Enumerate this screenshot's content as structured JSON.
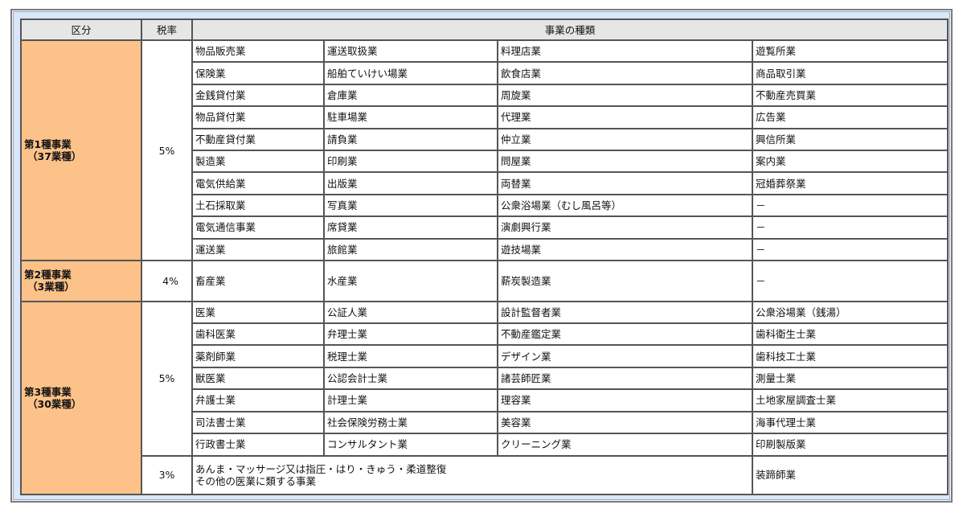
{
  "header": {
    "category": "区分",
    "rate": "税率",
    "types": "事業の種類"
  },
  "colors": {
    "category_bg": "#fdc289",
    "header_bg": "#e6e6e6",
    "frame_bg": "#d9e6fb"
  },
  "categories": [
    {
      "name": "第1種事業",
      "count": "（37業種）",
      "groups": [
        {
          "rate": "5%",
          "rows": [
            [
              "物品販売業",
              "運送取扱業",
              "料理店業",
              "遊覧所業"
            ],
            [
              "保険業",
              "船舶ていけい場業",
              "飲食店業",
              "商品取引業"
            ],
            [
              "金銭貸付業",
              "倉庫業",
              "周旋業",
              "不動産売買業"
            ],
            [
              "物品貸付業",
              "駐車場業",
              "代理業",
              "広告業"
            ],
            [
              "不動産貸付業",
              "請負業",
              "仲立業",
              "興信所業"
            ],
            [
              "製造業",
              "印刷業",
              "問屋業",
              "案内業"
            ],
            [
              "電気供給業",
              "出版業",
              "両替業",
              "冠婚葬祭業"
            ],
            [
              "土石採取業",
              "写真業",
              "公衆浴場業（むし風呂等）",
              "－"
            ],
            [
              "電気通信事業",
              "席貸業",
              "演劇興行業",
              "－"
            ],
            [
              "運送業",
              "旅館業",
              "遊技場業",
              "－"
            ]
          ]
        }
      ]
    },
    {
      "name": "第2種事業",
      "count": "（3業種）",
      "groups": [
        {
          "rate": "4%",
          "rows": [
            [
              "畜産業",
              "水産業",
              "薪炭製造業",
              "－"
            ]
          ]
        }
      ]
    },
    {
      "name": "第3種事業",
      "count": "（30業種）",
      "groups": [
        {
          "rate": "5%",
          "rows": [
            [
              "医業",
              "公証人業",
              "設計監督者業",
              "公衆浴場業（銭湯）"
            ],
            [
              "歯科医業",
              "弁理士業",
              "不動産鑑定業",
              "歯科衛生士業"
            ],
            [
              "薬剤師業",
              "税理士業",
              "デザイン業",
              "歯科技工士業"
            ],
            [
              "獣医業",
              "公認会計士業",
              "諸芸師匠業",
              "測量士業"
            ],
            [
              "弁護士業",
              "計理士業",
              "理容業",
              "土地家屋調査士業"
            ],
            [
              "司法書士業",
              "社会保険労務士業",
              "美容業",
              "海事代理士業"
            ],
            [
              "行政書士業",
              "コンサルタント業",
              "クリーニング業",
              "印刷製版業"
            ]
          ]
        },
        {
          "rate": "3%",
          "merged_line1": "あんま・マッサージ又は指圧・はり・きゅう・柔道整復",
          "merged_line2": "その他の医業に類する事業",
          "last": "装蹄師業"
        }
      ]
    }
  ]
}
